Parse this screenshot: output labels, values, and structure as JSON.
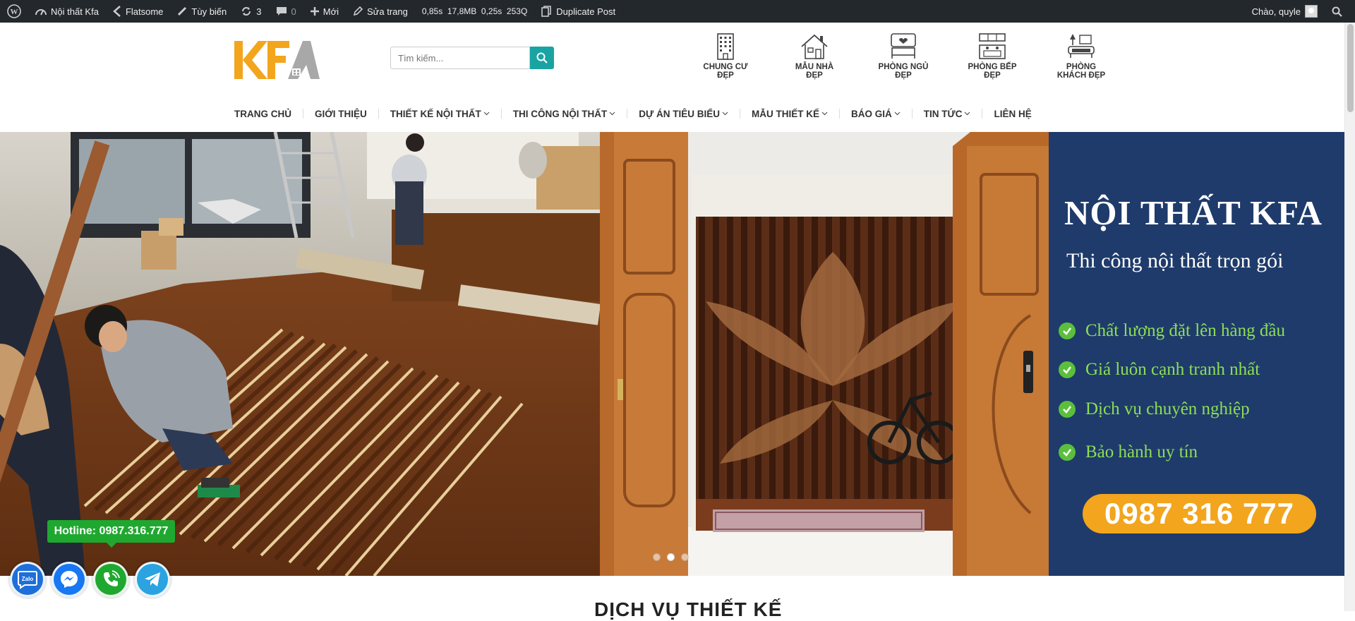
{
  "admin_bar": {
    "site_name": "Nội thất Kfa",
    "theme": "Flatsome",
    "customize": "Tùy biến",
    "updates_count": "3",
    "comments_count": "0",
    "new_label": "Mới",
    "edit_page": "Sửa trang",
    "perf_stats": "0,85s  17,8MB  0,25s  253Q",
    "duplicate_post": "Duplicate Post",
    "greeting": "Chào, quyle"
  },
  "header": {
    "search_placeholder": "Tìm kiếm...",
    "categories": [
      {
        "label": "CHUNG CƯ ĐẸP",
        "icon": "apartment-icon"
      },
      {
        "label": "MẪU NHÀ ĐẸP",
        "icon": "house-icon"
      },
      {
        "label": "PHÒNG NGỦ ĐẸP",
        "icon": "bedroom-icon"
      },
      {
        "label": "PHÒNG BẾP ĐẸP",
        "icon": "kitchen-icon"
      },
      {
        "label": "PHÒNG KHÁCH ĐẸP",
        "icon": "livingroom-icon"
      }
    ]
  },
  "nav": {
    "items": [
      {
        "label": "TRANG CHỦ",
        "dropdown": false
      },
      {
        "label": "GIỚI THIỆU",
        "dropdown": false
      },
      {
        "label": "THIẾT KẾ NỘI THẤT",
        "dropdown": true
      },
      {
        "label": "THI CÔNG NỘI THẤT",
        "dropdown": true
      },
      {
        "label": "DỰ ÁN TIÊU BIỂU",
        "dropdown": true
      },
      {
        "label": "MẪU THIẾT KẾ",
        "dropdown": true
      },
      {
        "label": "BÁO GIÁ",
        "dropdown": true
      },
      {
        "label": "TIN TỨC",
        "dropdown": true
      },
      {
        "label": "LIÊN HỆ",
        "dropdown": false
      }
    ]
  },
  "banner": {
    "title": "NỘI THẤT KFA",
    "subtitle": "Thi công nội thất trọn gói",
    "benefits": [
      "Chất lượng đặt lên hàng đầu",
      "Giá luôn cạnh tranh nhất",
      "Dịch vụ chuyên nghiệp",
      "Bảo hành uy tín"
    ],
    "phone": "0987 316 777",
    "active_slide": 2,
    "slide_count": 3
  },
  "section": {
    "title": "DỊCH VỤ THIẾT KẾ"
  },
  "floating": {
    "hotline": "Hotline: 0987.316.777",
    "zalo_label": "Zalo",
    "colors": {
      "zalo": "#1e6fd9",
      "messenger": "#1877f2",
      "phone": "#1fa82f",
      "telegram": "#2aa3e0"
    }
  },
  "colors": {
    "admin_bar": "#23282d",
    "accent": "#1aa3a3",
    "logo_orange": "#f2a51d",
    "banner_blue": "#1f3b6b",
    "benefit_green": "#8cde56"
  }
}
